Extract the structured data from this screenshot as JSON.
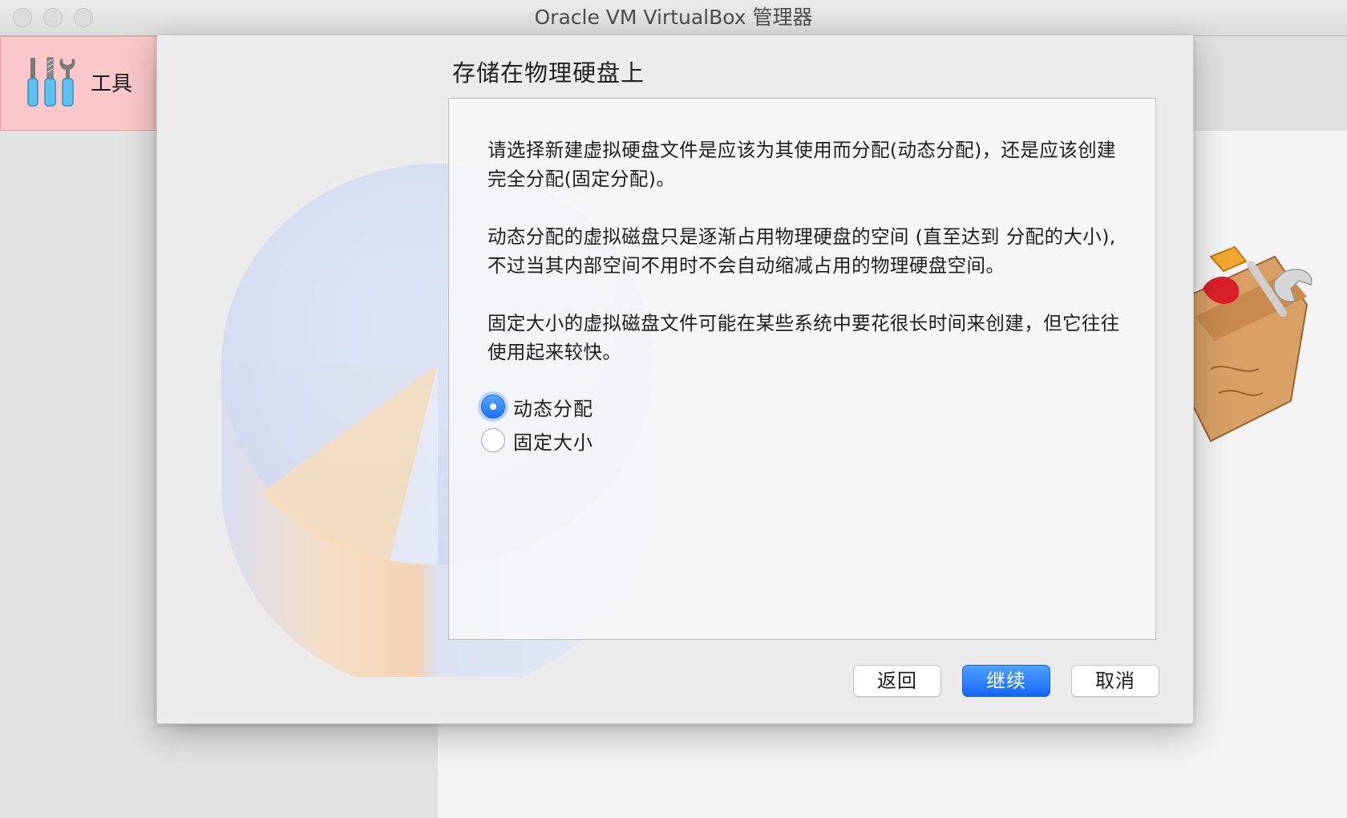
{
  "window": {
    "title": "Oracle VM VirtualBox 管理器",
    "traffic_lights": [
      "close-button",
      "minimize-button",
      "zoom-button"
    ]
  },
  "sidebar": {
    "tools_item": {
      "label": "工具",
      "icon": "tools-icon"
    }
  },
  "dialog": {
    "heading": "存储在物理硬盘上",
    "paragraphs": [
      "请选择新建虚拟硬盘文件是应该为其使用而分配(动态分配)，还是应该创建完全分配(固定分配)。",
      "动态分配的虚拟磁盘只是逐渐占用物理硬盘的空间 (直至达到 分配的大小), 不过当其内部空间不用时不会自动缩减占用的物理硬盘空间。",
      "固定大小的虚拟磁盘文件可能在某些系统中要花很长时间来创建，但它往往使用起来较快。"
    ],
    "options": [
      {
        "label": "动态分配",
        "selected": true
      },
      {
        "label": "固定大小",
        "selected": false
      }
    ],
    "buttons": {
      "back": "返回",
      "continue": "继续",
      "cancel": "取消"
    }
  },
  "colors": {
    "accent": "#1467f4",
    "selected_item_bg": "#fac8c8"
  }
}
